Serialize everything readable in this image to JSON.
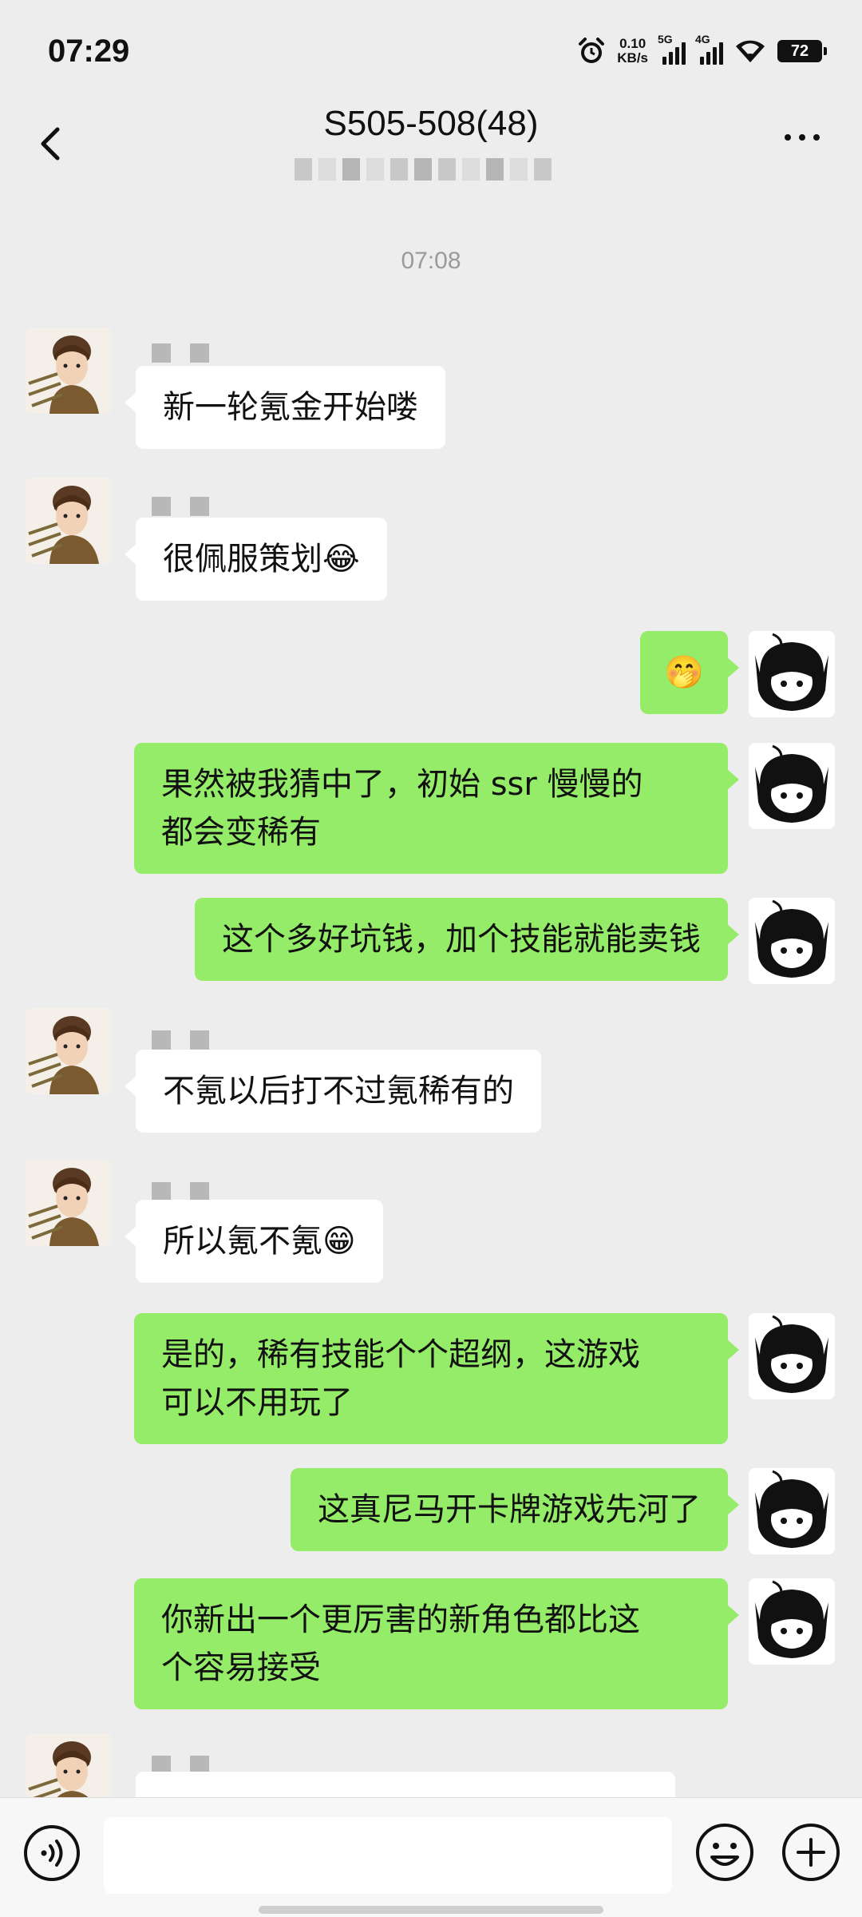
{
  "status_bar": {
    "time": "07:29",
    "net_speed_value": "0.10",
    "net_speed_unit": "KB/s",
    "sim1": "5G",
    "sim2": "4G",
    "battery": "72"
  },
  "header": {
    "title": "S505-508(48)",
    "back_icon": "chevron-left-icon",
    "more_icon": "more-dots-icon"
  },
  "timestamp": "07:08",
  "messages": [
    {
      "side": "in",
      "text": "新一轮氪金开始喽"
    },
    {
      "side": "in",
      "text": "很佩服策划",
      "emoji": "😂"
    },
    {
      "side": "out",
      "text": "",
      "emoji": "🤭"
    },
    {
      "side": "out",
      "line1": "果然被我猜中了，初始 ssr 慢慢的",
      "line2": "都会变稀有"
    },
    {
      "side": "out",
      "text": "这个多好坑钱，加个技能就能卖钱"
    },
    {
      "side": "in",
      "text": "不氪以后打不过氪稀有的"
    },
    {
      "side": "in",
      "text": "所以氪不氪",
      "emoji": "😁"
    },
    {
      "side": "out",
      "line1": "是的，稀有技能个个超纲，这游戏",
      "line2": "可以不用玩了"
    },
    {
      "side": "out",
      "text": "这真尼马开卡牌游戏先河了"
    },
    {
      "side": "out",
      "line1": "你新出一个更厉害的新角色都比这",
      "line2": "个容易接受"
    }
  ],
  "input_bar": {
    "voice_icon": "voice-icon",
    "emoji_icon": "emoji-smile-icon",
    "plus_icon": "plus-circle-icon",
    "placeholder": ""
  },
  "colors": {
    "background": "#ededed",
    "outgoing_bubble": "#95ec69",
    "incoming_bubble": "#ffffff"
  }
}
